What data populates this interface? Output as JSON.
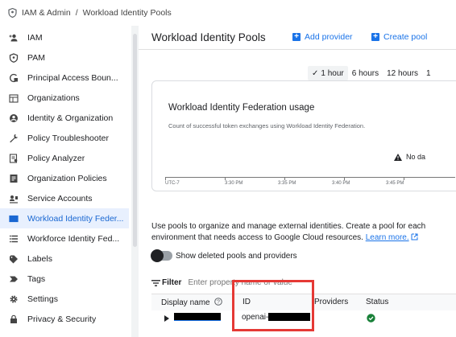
{
  "breadcrumb": {
    "section": "IAM & Admin",
    "separator": "/",
    "current": "Workload Identity Pools"
  },
  "sidebar": {
    "items": [
      {
        "label": "IAM",
        "icon": "person-add-icon",
        "active": false
      },
      {
        "label": "PAM",
        "icon": "shield-icon",
        "active": false
      },
      {
        "label": "Principal Access Boun...",
        "icon": "access-boundary-icon",
        "active": false
      },
      {
        "label": "Organizations",
        "icon": "organization-icon",
        "active": false
      },
      {
        "label": "Identity & Organization",
        "icon": "account-circle-icon",
        "active": false
      },
      {
        "label": "Policy Troubleshooter",
        "icon": "wrench-icon",
        "active": false
      },
      {
        "label": "Policy Analyzer",
        "icon": "analyzer-icon",
        "active": false
      },
      {
        "label": "Organization Policies",
        "icon": "policy-list-icon",
        "active": false
      },
      {
        "label": "Service Accounts",
        "icon": "service-account-icon",
        "active": false
      },
      {
        "label": "Workload Identity Feder...",
        "icon": "id-card-icon",
        "active": true
      },
      {
        "label": "Workforce Identity Fed...",
        "icon": "list-icon",
        "active": false
      },
      {
        "label": "Labels",
        "icon": "label-icon",
        "active": false
      },
      {
        "label": "Tags",
        "icon": "tag-icon",
        "active": false
      },
      {
        "label": "Settings",
        "icon": "gear-icon",
        "active": false
      },
      {
        "label": "Privacy & Security",
        "icon": "lock-icon",
        "active": false
      }
    ]
  },
  "header": {
    "title": "Workload Identity Pools",
    "add_provider": "Add provider",
    "create_pool": "Create pool"
  },
  "time_range": {
    "options": [
      "1 hour",
      "6 hours",
      "12 hours",
      "1"
    ],
    "selected": "1 hour",
    "check": "✓"
  },
  "usage_card": {
    "title": "Workload Identity Federation usage",
    "subtitle": "Count of successful token exchanges using Workload Identity Federation.",
    "no_data": "No da",
    "x_ticks": [
      "UTC-7",
      "3:30 PM",
      "3:35 PM",
      "3:40 PM",
      "3:45 PM"
    ]
  },
  "description": {
    "text": "Use pools to organize and manage external identities. Create a pool for each environment that needs access to Google Cloud resources. ",
    "link": "Learn more."
  },
  "toggle": {
    "label": "Show deleted pools and providers",
    "on": false
  },
  "filter": {
    "label": "Filter",
    "placeholder": "Enter property name or value"
  },
  "table": {
    "columns": [
      "Display name",
      "ID",
      "Providers",
      "Status"
    ],
    "rows": [
      {
        "display_name": "",
        "id": "openai-",
        "providers": "",
        "status": "enabled"
      }
    ]
  },
  "colors": {
    "accent": "#1a73e8",
    "active_bg": "#e8f0fe",
    "highlight": "#e53935",
    "status_ok": "#188038"
  }
}
